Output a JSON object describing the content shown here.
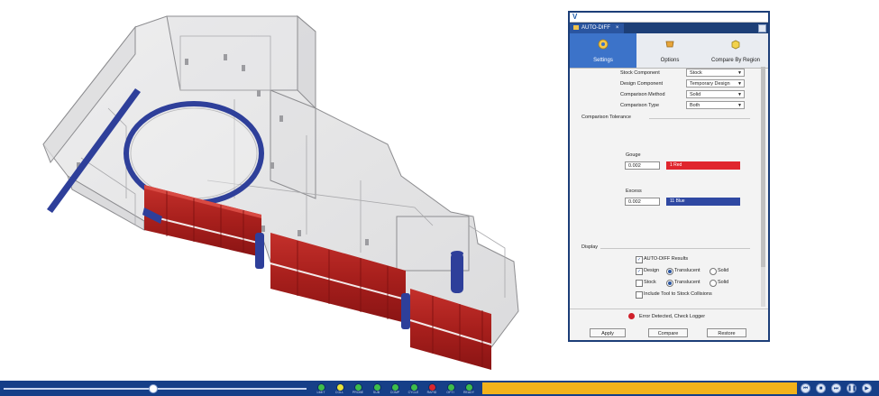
{
  "panel": {
    "app_logo": "V",
    "tab_title": "AUTO-DIFF",
    "tab_close": "×",
    "pages": [
      {
        "label": "Settings",
        "icon": "gear-icon",
        "active": true
      },
      {
        "label": "Options",
        "icon": "options-icon",
        "active": false
      },
      {
        "label": "Compare By Region",
        "icon": "box-region-icon",
        "active": false
      }
    ],
    "fields": [
      {
        "label": "Stock Component",
        "value": "Stock"
      },
      {
        "label": "Design Component",
        "value": "Temporary Design"
      },
      {
        "label": "Comparison Method",
        "value": "Solid"
      },
      {
        "label": "Comparison Type",
        "value": "Both"
      }
    ],
    "tolerance": {
      "title": "Comparison Tolerance",
      "gouge_label": "Gouge",
      "gouge_value": "0.002",
      "gouge_color_label": "1 Red",
      "gouge_color": "#e0262e",
      "excess_label": "Excess",
      "excess_value": "0.002",
      "excess_color_label": "11 Blue",
      "excess_color": "#2f48a2"
    },
    "display": {
      "title": "Display",
      "auto_diff_results": "AUTO-DIFF Results",
      "design_label": "Design",
      "stock_label": "Stock",
      "translucent_label": "Translucent",
      "solid_label": "Solid",
      "include_label": "Include Tool to Stock Collisions"
    },
    "error_text": "Error Detected, Check Logger",
    "error_color": "#d0202a",
    "buttons": {
      "apply": "Apply",
      "compare": "Compare",
      "restore": "Restore"
    }
  },
  "status_bar": {
    "lights": [
      {
        "label": "LIMIT",
        "color": "#3ebd4b"
      },
      {
        "label": "COLL",
        "color": "#e6e23b"
      },
      {
        "label": "PROBE",
        "color": "#3ebd4b"
      },
      {
        "label": "SUB",
        "color": "#3ebd4b"
      },
      {
        "label": "COMP",
        "color": "#3ebd4b"
      },
      {
        "label": "CYCLE",
        "color": "#3ebd4b"
      },
      {
        "label": "RAPID",
        "color": "#d9272e"
      },
      {
        "label": "OPTI",
        "color": "#3ebd4b"
      },
      {
        "label": "READY",
        "color": "#3ebd4b"
      }
    ],
    "progress": 1.0,
    "slider_position": 0.49,
    "accent": "#163f88",
    "progress_color": "#f2b21b",
    "controls": [
      "rewind-icon",
      "stop-icon",
      "step-icon",
      "pause-icon",
      "play-icon"
    ],
    "control_glyphs": [
      "⏮",
      "■",
      "⏭",
      "❚❚",
      "▶"
    ]
  },
  "viewport": {
    "gouge_color": "#b3211e",
    "excess_color": "#2e3f9a"
  }
}
